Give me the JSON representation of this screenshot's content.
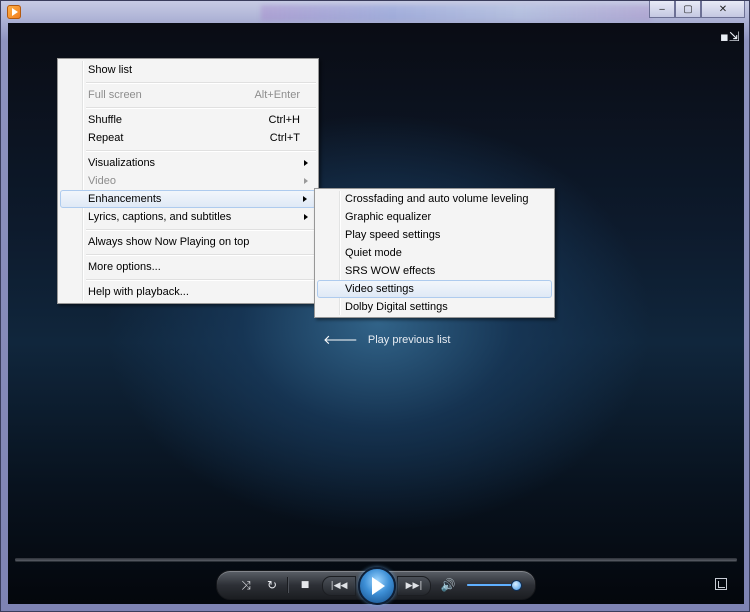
{
  "window": {
    "caption_buttons": {
      "minimize": "‒",
      "maximize": "▢",
      "close": "✕"
    },
    "mini_mode_icon": "▪⇲"
  },
  "context_menu": {
    "items": [
      {
        "label": "Show list",
        "shortcut": "",
        "disabled": false,
        "submenu": false
      },
      {
        "separator": true
      },
      {
        "label": "Full screen",
        "shortcut": "Alt+Enter",
        "disabled": true,
        "submenu": false
      },
      {
        "separator": true
      },
      {
        "label": "Shuffle",
        "shortcut": "Ctrl+H",
        "disabled": false,
        "submenu": false
      },
      {
        "label": "Repeat",
        "shortcut": "Ctrl+T",
        "disabled": false,
        "submenu": false
      },
      {
        "separator": true
      },
      {
        "label": "Visualizations",
        "shortcut": "",
        "disabled": false,
        "submenu": true
      },
      {
        "label": "Video",
        "shortcut": "",
        "disabled": true,
        "submenu": true
      },
      {
        "label": "Enhancements",
        "shortcut": "",
        "disabled": false,
        "submenu": true,
        "highlighted": true
      },
      {
        "label": "Lyrics, captions, and subtitles",
        "shortcut": "",
        "disabled": false,
        "submenu": true
      },
      {
        "separator": true
      },
      {
        "label": "Always show Now Playing on top",
        "shortcut": "",
        "disabled": false,
        "submenu": false
      },
      {
        "separator": true
      },
      {
        "label": "More options...",
        "shortcut": "",
        "disabled": false,
        "submenu": false
      },
      {
        "separator": true
      },
      {
        "label": "Help with playback...",
        "shortcut": "",
        "disabled": false,
        "submenu": false
      }
    ]
  },
  "enhancements_submenu": {
    "items": [
      {
        "label": "Crossfading and auto volume leveling"
      },
      {
        "label": "Graphic equalizer"
      },
      {
        "label": "Play speed settings"
      },
      {
        "label": "Quiet mode"
      },
      {
        "label": "SRS WOW effects"
      },
      {
        "label": "Video settings",
        "highlighted": true
      },
      {
        "label": "Dolby Digital settings"
      }
    ]
  },
  "play_previous": {
    "label": "Play previous list",
    "icon": "left-arrow-icon"
  },
  "controls": {
    "shuffle_glyph": "⤨",
    "repeat_glyph": "↻",
    "stop_glyph": "■",
    "prev_glyph": "|◀◀",
    "next_glyph": "▶▶|",
    "volume_glyph": "🔊",
    "volume_level": 0.95
  },
  "colors": {
    "menu_highlight_border": "#aecbee",
    "play_button": "#3d8fd6",
    "volume_fill": "#5fb0ff"
  }
}
